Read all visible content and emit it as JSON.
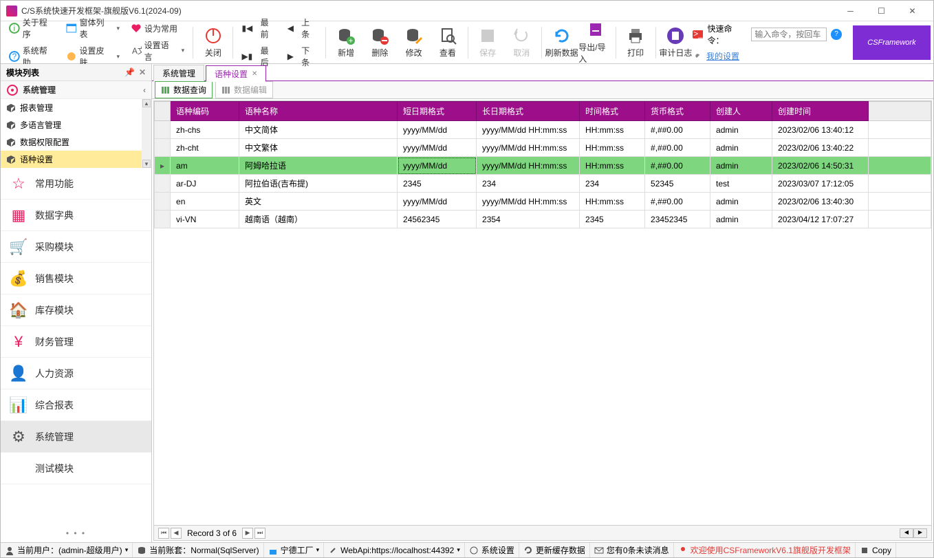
{
  "window": {
    "title": "C/S系统快速开发框架-旗舰版V6.1(2024-09)"
  },
  "toolbar_small": {
    "about": "关于程序",
    "formlist": "窗体列表",
    "set_usual": "设为常用",
    "syshelp": "系统帮助",
    "set_skin": "设置皮肤",
    "set_lang": "设置语言"
  },
  "toolbar_nav": {
    "first": "最前",
    "prev": "上条",
    "last": "最后",
    "next": "下条"
  },
  "toolbar_big": {
    "close": "关闭",
    "add": "新增",
    "delete": "删除",
    "modify": "修改",
    "view": "查看",
    "save": "保存",
    "cancel": "取消",
    "refresh": "刷新数据",
    "export": "导出/导入",
    "print": "打印",
    "audit": "审计日志"
  },
  "right": {
    "quick_label": "快速命令：",
    "quick_placeholder": "输入命令，按回车",
    "my_settings": "我的设置",
    "logo": "CSFramework"
  },
  "sidebar": {
    "header": "模块列表",
    "section": "系统管理",
    "subitems": [
      "报表管理",
      "多语言管理",
      "数据权限配置",
      "语种设置"
    ],
    "nav": [
      {
        "label": "常用功能",
        "color": "#e91e63"
      },
      {
        "label": "数据字典",
        "color": "#e91e63"
      },
      {
        "label": "采购模块",
        "color": "#e91e63"
      },
      {
        "label": "销售模块",
        "color": "#e91e63"
      },
      {
        "label": "库存模块",
        "color": "#e91e63"
      },
      {
        "label": "财务管理",
        "color": "#e91e63"
      },
      {
        "label": "人力资源",
        "color": "#e91e63"
      },
      {
        "label": "综合报表",
        "color": "#e91e63"
      },
      {
        "label": "系统管理",
        "color": "#444",
        "active": true
      },
      {
        "label": "测试模块",
        "color": "#e91e63"
      }
    ]
  },
  "tabs": {
    "items": [
      {
        "label": "系统管理",
        "active": false,
        "closable": false
      },
      {
        "label": "语种设置",
        "active": true,
        "closable": true
      }
    ],
    "subtabs": [
      {
        "label": "数据查询",
        "active": true
      },
      {
        "label": "数据编辑",
        "active": false
      }
    ]
  },
  "grid": {
    "columns": [
      "语种编码",
      "语种名称",
      "短日期格式",
      "长日期格式",
      "时间格式",
      "货币格式",
      "创建人",
      "创建时间"
    ],
    "rows": [
      {
        "sel": false,
        "cells": [
          "zh-chs",
          "中文简体",
          "yyyy/MM/dd",
          "yyyy/MM/dd HH:mm:ss",
          "HH:mm:ss",
          "#,##0.00",
          "admin",
          "2023/02/06 13:40:12"
        ]
      },
      {
        "sel": false,
        "cells": [
          "zh-cht",
          "中文繁体",
          "yyyy/MM/dd",
          "yyyy/MM/dd HH:mm:ss",
          "HH:mm:ss",
          "#,##0.00",
          "admin",
          "2023/02/06 13:40:22"
        ]
      },
      {
        "sel": true,
        "cells": [
          "am",
          "阿姆哈拉语",
          "yyyy/MM/dd",
          "yyyy/MM/dd HH:mm:ss",
          "HH:mm:ss",
          "#,##0.00",
          "admin",
          "2023/02/06 14:50:31"
        ]
      },
      {
        "sel": false,
        "cells": [
          "ar-DJ",
          "阿拉伯语(吉布提)",
          "2345",
          "234",
          "234",
          "52345",
          "test",
          "2023/03/07 17:12:05"
        ]
      },
      {
        "sel": false,
        "cells": [
          "en",
          "英文",
          "yyyy/MM/dd",
          "yyyy/MM/dd HH:mm:ss",
          "HH:mm:ss",
          "#,##0.00",
          "admin",
          "2023/02/06 13:40:30"
        ]
      },
      {
        "sel": false,
        "cells": [
          "vi-VN",
          "越南语（越南）",
          "24562345",
          "2354",
          "2345",
          "23452345",
          "admin",
          "2023/04/12 17:07:27"
        ]
      }
    ],
    "footer": "Record 3 of 6"
  },
  "statusbar": {
    "user": "当前用户：(admin-超级用户)",
    "account": "当前账套：Normal(SqlServer)",
    "factory": "宁德工厂",
    "webapi": "WebApi:https://localhost:44392",
    "syssettings": "系统设置",
    "cache": "更新缓存数据",
    "mail": "您有0条未读消息",
    "welcome": "欢迎使用CSFrameworkV6.1旗舰版开发框架",
    "copy": "Copy"
  }
}
